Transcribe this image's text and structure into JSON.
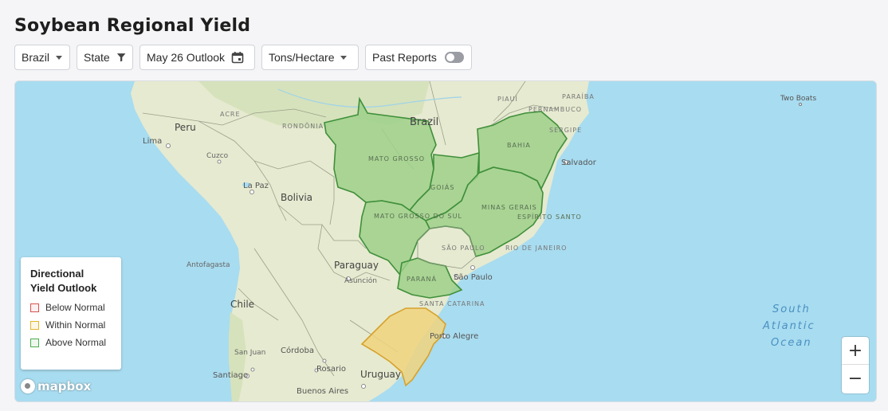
{
  "page": {
    "title": "Soybean Regional Yield"
  },
  "toolbar": {
    "country": "Brazil",
    "level": "State",
    "outlook": "May 26 Outlook",
    "units": "Tons/Hectare",
    "past_reports": "Past Reports",
    "past_reports_on": false
  },
  "legend": {
    "title": "Directional Yield Outlook",
    "items": [
      {
        "label": "Below Normal",
        "color": "#d9534f"
      },
      {
        "label": "Within Normal",
        "color": "#e5b62f"
      },
      {
        "label": "Above Normal",
        "color": "#4caf50"
      }
    ]
  },
  "map": {
    "colors": {
      "ocean": "#a8dcf0",
      "land": "#e6ead0",
      "above": "#9ed089",
      "within": "#f0d37e"
    },
    "labels": {
      "peru": "Peru",
      "lima": "Lima",
      "cuzco": "Cuzco",
      "la_paz": "La Paz",
      "bolivia": "Bolivia",
      "acre": "ACRE",
      "rondonia": "RONDÔNIA",
      "brazil": "Brazil",
      "piaui": "PIAUÍ",
      "paraiba": "PARAÍBA",
      "pernambuco": "PERNAMBUCO",
      "sergipe": "SERGIPE",
      "bahia": "BAHIA",
      "salvador": "Salvador",
      "mato_grosso": "MATO GROSSO",
      "goias": "GOIÁS",
      "minas_gerais": "MINAS GERAIS",
      "espirito_santo": "ESPÍRITO SANTO",
      "mato_grosso_do_sul": "MATO GROSSO DO SUL",
      "sao_paulo_state": "SÃO PAULO",
      "rio_de_janeiro": "RIO DE JANEIRO",
      "sao_paulo_city": "São Paulo",
      "parana": "PARANÁ",
      "santa_catarina": "SANTA CATARINA",
      "porto_alegre": "Porto Alegre",
      "paraguay": "Paraguay",
      "asuncion": "Asunción",
      "antofagasta": "Antofagasta",
      "chile": "Chile",
      "san_juan": "San Juan",
      "cordoba": "Córdoba",
      "rosario": "Rosario",
      "santiago": "Santiago",
      "uruguay": "Uruguay",
      "buenos_aires": "Buenos Aires",
      "two_boats": "Two Boats",
      "south": "South",
      "atlantic": "Atlantic",
      "ocean": "Ocean"
    },
    "zoom_in": "+",
    "zoom_out": "−",
    "attribution": "mapbox"
  }
}
